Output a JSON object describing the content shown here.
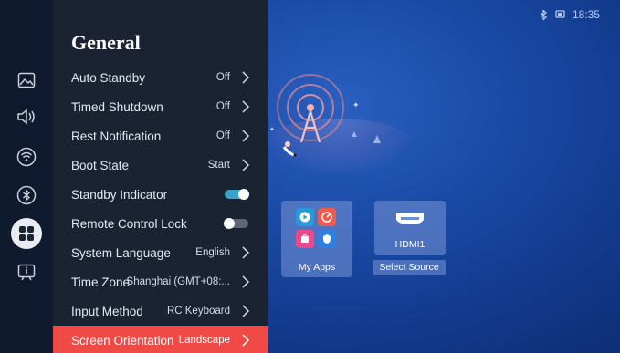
{
  "status_bar": {
    "time": "18:35",
    "icons": [
      "bluetooth-icon",
      "screen-icon"
    ]
  },
  "nav": {
    "items": [
      {
        "name": "picture-icon"
      },
      {
        "name": "sound-icon"
      },
      {
        "name": "wifi-icon"
      },
      {
        "name": "bluetooth-icon"
      },
      {
        "name": "general-icon",
        "active": true
      },
      {
        "name": "about-icon"
      }
    ]
  },
  "panel": {
    "title": "General",
    "rows": [
      {
        "label": "Auto Standby",
        "value": "Off"
      },
      {
        "label": "Timed Shutdown",
        "value": "Off"
      },
      {
        "label": "Rest Notification",
        "value": "Off"
      },
      {
        "label": "Boot State",
        "value": "Start"
      },
      {
        "label": "Standby Indicator",
        "toggle": "on"
      },
      {
        "label": "Remote Control Lock",
        "toggle": "off"
      },
      {
        "label": "System Language",
        "value": "English"
      },
      {
        "label": "Time Zone",
        "value": "Shanghai (GMT+08:..."
      },
      {
        "label": "Input Method",
        "value": "RC Keyboard"
      },
      {
        "label": "Screen Orientation",
        "value": "Landscape",
        "selected": true
      }
    ]
  },
  "tiles": {
    "my_apps": {
      "label": "My Apps"
    },
    "hdmi": {
      "label": "HDMI1"
    },
    "select_source": "Select Source"
  },
  "colors": {
    "accent": "#f04a47",
    "toggle_on": "#3aa3c8",
    "panel": "#1b2333",
    "nav": "#101a2e"
  }
}
